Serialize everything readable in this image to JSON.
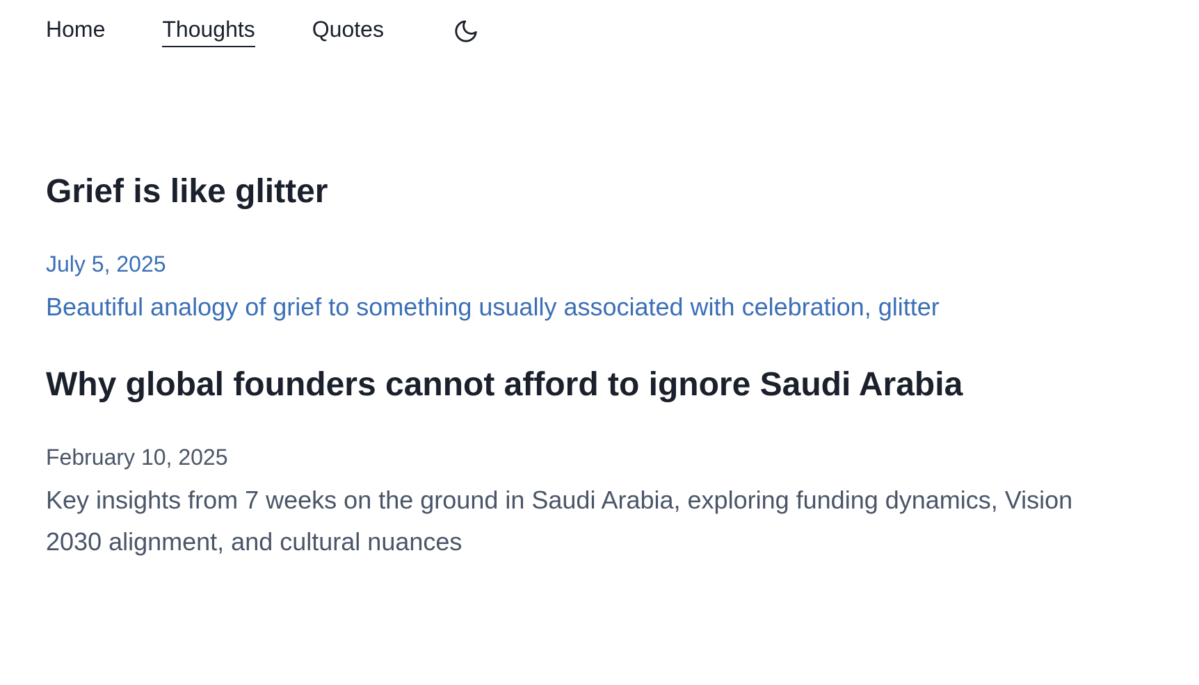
{
  "nav": {
    "links": [
      {
        "label": "Home"
      },
      {
        "label": "Thoughts"
      },
      {
        "label": "Quotes"
      }
    ],
    "active": "Thoughts",
    "theme_icon": "moon-icon"
  },
  "posts": [
    {
      "title": "Grief is like glitter",
      "date": "July 5, 2025",
      "excerpt": "Beautiful analogy of grief to something usually associated with celebration, glitter"
    },
    {
      "title": "Why global founders cannot afford to ignore Saudi Arabia",
      "date": "February 10, 2025",
      "excerpt": "Key insights from 7 weeks on the ground in Saudi Arabia, exploring funding dynamics, Vision 2030 alignment, and cultural nuances"
    }
  ],
  "colors": {
    "text": "#1a202c",
    "accent": "#3b6fb6",
    "muted": "#4a5568"
  }
}
